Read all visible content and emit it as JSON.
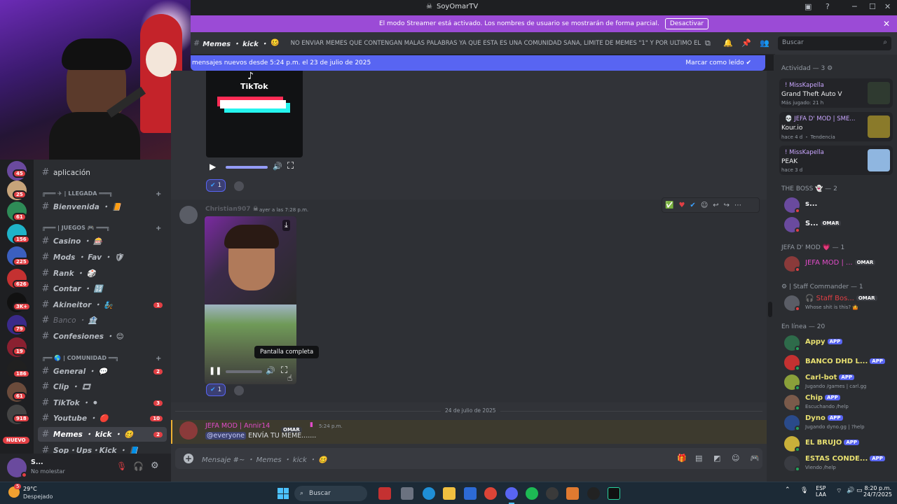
{
  "window": {
    "title": "SoyOmarTV"
  },
  "banner": {
    "text": "El modo Streamer está activado. Los nombres de usuario se mostrarán de forma parcial.",
    "button": "Desactivar"
  },
  "header": {
    "channel_name": "Memes ・ kick ・",
    "topic": "NO ENVIAR MEMES QUE CONTENGAN MALAS PALABRAS YA QUE ESTA ES UNA COMUNIDAD SANA, LIMITE DE MEMES \"1\" Y POR ULTIMO EL ...",
    "search_placeholder": "Buscar"
  },
  "newbar": {
    "text": "mensajes nuevos desde 5:24 p.m. el 23 de julio de 2025",
    "action": "Marcar como leído"
  },
  "guild_badges": [
    "45",
    "25",
    "61",
    "156",
    "225",
    "626",
    "3K+",
    "79",
    "19",
    "186",
    "61",
    "918"
  ],
  "guild_nuevo": "NUEVO",
  "channels": {
    "top": [
      {
        "name": "aplicación"
      }
    ],
    "cat_llegada": "╔═══ ✈ | LLEGADA ═══╗",
    "llegada": [
      {
        "name": "Bienvenida ・ 📙"
      }
    ],
    "cat_juegos": "╔═══ | JUEGOS 🎮 ═══╗",
    "juegos": [
      {
        "name": "Casino ・ 🎰",
        "badge": ""
      },
      {
        "name": "Mods ・ Fav ・ 🛡",
        "badge": ""
      },
      {
        "name": "Rank ・ 🎲",
        "badge": ""
      },
      {
        "name": "Contar ・ 🔢",
        "badge": ""
      },
      {
        "name": "Akineitor ・ 🧞",
        "badge": "1"
      },
      {
        "name": "Banco ・ 🏦",
        "badge": ""
      },
      {
        "name": "Confesiones ・ 😊",
        "badge": ""
      }
    ],
    "cat_comunidad": "╔══ 🌎 | COMUNIDAD ══╗",
    "comunidad": [
      {
        "name": "General ・ 💬",
        "badge": "2"
      },
      {
        "name": "Clip ・ 🎞",
        "badge": ""
      },
      {
        "name": "TikTok ・ ⚫",
        "badge": "3"
      },
      {
        "name": "Youtube ・ 🔴",
        "badge": "10"
      },
      {
        "name": "Memes ・ kick ・ 🥴",
        "badge": "2"
      },
      {
        "name": "Sop・Ups・Kick ・ 📘",
        "badge": ""
      }
    ]
  },
  "user": {
    "name": "S...",
    "status": "No molestar"
  },
  "messages": {
    "tiktok_label": "TikTok",
    "reaction1_count": "1",
    "msg2": {
      "author": "Christian907",
      "time": "ayer a las 7:28 p.m.",
      "tooltip": "Pantalla completa",
      "reaction_count": "1"
    },
    "date_divider": "24 de julio de 2025",
    "msg3": {
      "author": "JEFA MOD | Annir14",
      "role": "OMAR",
      "time": "5:24 p.m.",
      "mention": "@everyone",
      "text": "ENVÍA TU MEME......."
    }
  },
  "composer": {
    "placeholder": "Mensaje #~ ・ Memes ・ kick ・ 🥴"
  },
  "members": {
    "activity_head": "Actividad — 3",
    "activities": [
      {
        "name": "! MissKapella",
        "game": "Grand Theft Auto V",
        "time": "Más jugado: 21 h"
      },
      {
        "name": "💀 JEFA D' MOD | SME...",
        "game": "Kour.io",
        "time": "hace 4 d ・ Tendencia"
      },
      {
        "name": "! MissKapella",
        "game": "PEAK",
        "time": "hace 3 d"
      }
    ],
    "boss_head": "THE BOSS 👻 — 2",
    "boss": [
      {
        "name": "s...",
        "role": ""
      },
      {
        "name": "S...",
        "role": "OMAR"
      }
    ],
    "jefa_head": "JEFA D' MOD 💗 — 1",
    "jefa": [
      {
        "name": "JEFA MOD | ...",
        "role": "OMAR"
      }
    ],
    "staff_head": "⚙ | Staff Commander — 1",
    "staff": [
      {
        "name": "🎧 Staff Bos...",
        "role": "OMAR",
        "sub": "Whose shit is this? 🤷"
      }
    ],
    "online_head": "En línea — 20",
    "online": [
      {
        "name": "Appy",
        "tag": "APP",
        "sub": ""
      },
      {
        "name": "BANCO DHD L...",
        "tag": "APP",
        "sub": ""
      },
      {
        "name": "Carl-bot",
        "tag": "APP",
        "sub": "Jugando /games | carl.gg"
      },
      {
        "name": "Chip",
        "tag": "APP",
        "sub": "Escuchando /help"
      },
      {
        "name": "Dyno",
        "tag": "APP",
        "sub": "Jugando dyno.gg | ?help"
      },
      {
        "name": "EL BRUJO",
        "tag": "APP",
        "sub": ""
      },
      {
        "name": "ESTAS CONDE...",
        "tag": "APP",
        "sub": "Viendo /help"
      }
    ]
  },
  "taskbar": {
    "weather_temp": "29°C",
    "weather_desc": "Despejado",
    "weather_badge": "5",
    "search": "Buscar",
    "lang1": "ESP",
    "lang2": "LAA",
    "time": "8:20 p.m.",
    "date": "24/7/2025"
  },
  "colors": {
    "accent": "#5865f2",
    "banner": "#9b4bd6",
    "danger": "#e23f44",
    "online": "#23a55a"
  }
}
